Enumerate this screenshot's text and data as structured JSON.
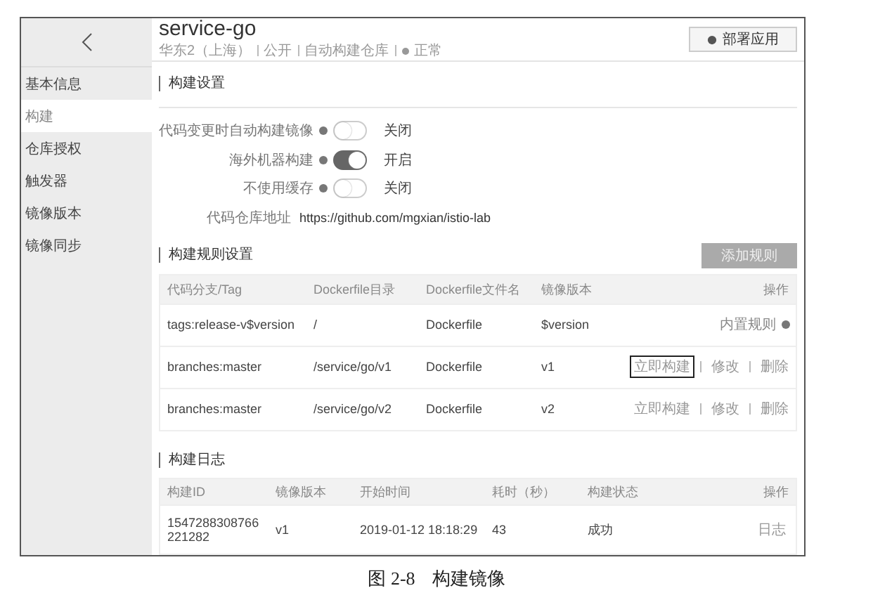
{
  "sidebar": {
    "items": [
      {
        "label": "基本信息",
        "selected": false
      },
      {
        "label": "构建",
        "selected": true
      },
      {
        "label": "仓库授权",
        "selected": false
      },
      {
        "label": "触发器",
        "selected": false
      },
      {
        "label": "镜像版本",
        "selected": false
      },
      {
        "label": "镜像同步",
        "selected": false
      }
    ]
  },
  "header": {
    "title": "service-go",
    "region": "华东2（上海）",
    "visibility": "公开",
    "type": "自动构建仓库",
    "status": "正常",
    "deploy_button": "部署应用"
  },
  "build_settings": {
    "title": "构建设置",
    "toggles": [
      {
        "label": "代码变更时自动构建镜像",
        "on": false,
        "state_label": "关闭"
      },
      {
        "label": "海外机器构建",
        "on": true,
        "state_label": "开启"
      },
      {
        "label": "不使用缓存",
        "on": false,
        "state_label": "关闭"
      }
    ],
    "repo": {
      "label": "代码仓库地址",
      "value": "https://github.com/mgxian/istio-lab"
    }
  },
  "rules": {
    "title": "构建规则设置",
    "add_button": "添加规则",
    "columns": [
      "代码分支/Tag",
      "Dockerfile目录",
      "Dockerfile文件名",
      "镜像版本",
      "操作"
    ],
    "rows": [
      {
        "kind": "builtin",
        "cells": [
          "tags:release-v$version",
          "/",
          "Dockerfile",
          "$version"
        ],
        "note": "内置规则"
      },
      {
        "kind": "custom",
        "cells": [
          "branches:master",
          "/service/go/v1",
          "Dockerfile",
          "v1"
        ],
        "actions": [
          {
            "label": "立即构建",
            "focused": true
          },
          {
            "label": "修改",
            "focused": false
          },
          {
            "label": "删除",
            "focused": false
          }
        ]
      },
      {
        "kind": "custom",
        "cells": [
          "branches:master",
          "/service/go/v2",
          "Dockerfile",
          "v2"
        ],
        "actions": [
          {
            "label": "立即构建",
            "focused": false
          },
          {
            "label": "修改",
            "focused": false
          },
          {
            "label": "删除",
            "focused": false
          }
        ]
      }
    ]
  },
  "log": {
    "title": "构建日志",
    "columns": [
      "构建ID",
      "镜像版本",
      "开始时间",
      "耗时（秒）",
      "构建状态",
      "操作"
    ],
    "rows": [
      {
        "cells": [
          "1547288308766221282",
          "v1",
          "2019-01-12 18:18:29",
          "43",
          "成功"
        ],
        "action": "日志"
      }
    ]
  },
  "caption": {
    "number": "图 2-8",
    "text": "构建镜像"
  }
}
